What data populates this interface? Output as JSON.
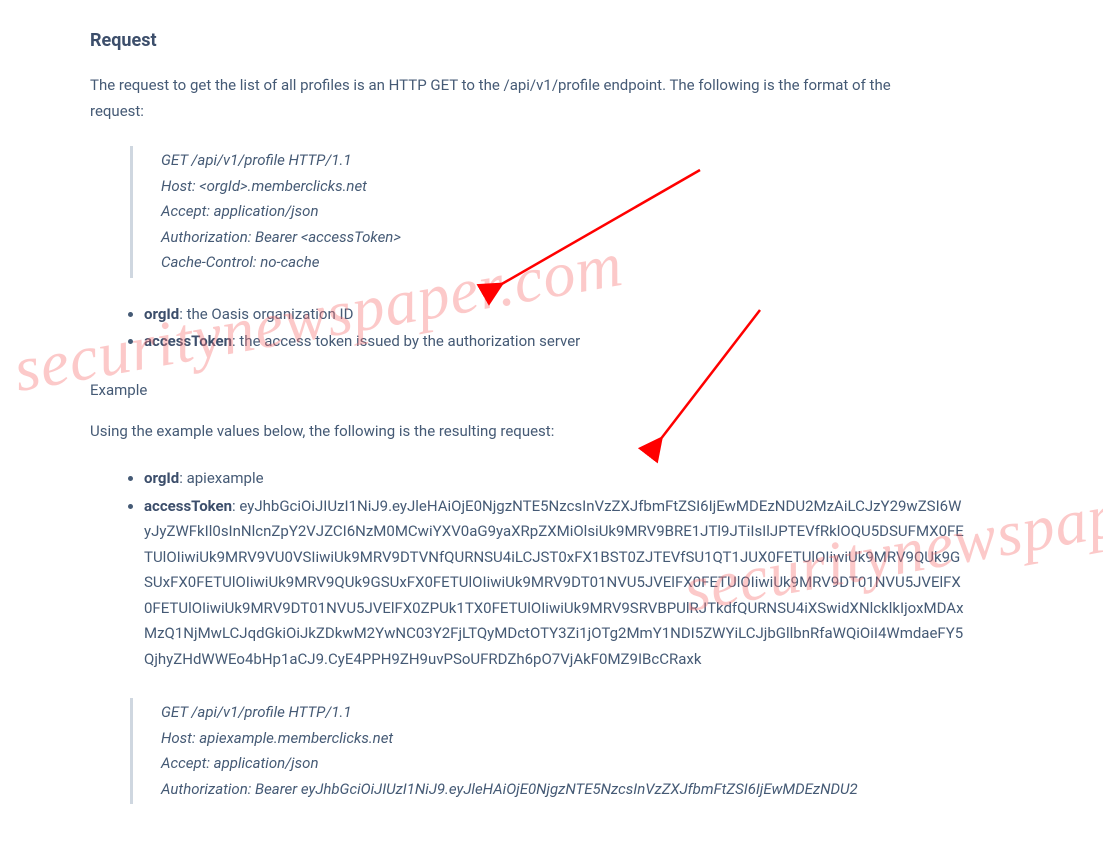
{
  "heading": "Request",
  "intro": "The request to get the list of all profiles is an HTTP GET to the /api/v1/profile endpoint.  The following is the format of the request:",
  "code1": {
    "l1": "GET /api/v1/profile HTTP/1.1",
    "l2": "Host: <orgId>.memberclicks.net",
    "l3": "Accept: application/json",
    "l4": "Authorization: Bearer <accessToken>",
    "l5": "Cache-Control: no-cache"
  },
  "params1": {
    "orgId_label": "orgId",
    "orgId_desc": ": the Oasis organization ID",
    "accessToken_label": "accessToken",
    "accessToken_desc": ": the access token issued by the authorization server"
  },
  "example_heading": "Example",
  "example_intro": "Using the example values below, the following is the resulting request:",
  "params2": {
    "orgId_label": "orgId",
    "orgId_value": ": apiexample",
    "accessToken_label": "accessToken",
    "accessToken_value": ": eyJhbGciOiJIUzI1NiJ9.eyJleHAiOjE0NjgzNTE5NzcsInVzZXJfbmFtZSI6IjEwMDEzNDU2MzAiLCJzY29wZSI6WyJyZWFkIl0sInNlcnZpY2VJZCI6NzM0MCwiYXV0aG9yaXRpZXMiOlsiUk9MRV9BRE1JTl9JTiIsIlJPTEVfRklOQU5DSUFMX0FETUlOIiwiUk9MRV9VU0VSIiwiUk9MRV9DTVNfQURNSU4iLCJST0xFX1BST0ZJTEVfSU1QT1JUX0FETUlOIiwiUk9MRV9QUk9GSUxFX0FETUlOIiwiUk9MRV9QUk9GSUxFX0FETUlOIiwiUk9MRV9DT01NVU5JVElFX0FETUlOIiwiUk9MRV9DT01NVU5JVElFX0FETUlOIiwiUk9MRV9DT01NVU5JVElFX0ZPUk1TX0FETUlOIiwiUk9MRV9SRVBPUlRJTkdfQURNSU4iXSwidXNlcklkIjoxMDAxMzQ1NjMwLCJqdGkiOiJkZDkwM2YwNC03Y2FjLTQyMDctOTY3Zi1jOTg2MmY1NDI5ZWYiLCJjbGllbnRfaWQiOiI4WmdaeFY5QjhyZHdWWEo4bHp1aCJ9.CyE4PPH9ZH9uvPSoUFRDZh6pO7VjAkF0MZ9IBcCRaxk"
  },
  "code2": {
    "l1": "GET /api/v1/profile HTTP/1.1",
    "l2": "Host: apiexample.memberclicks.net",
    "l3": "Accept: application/json",
    "l4": "Authorization: Bearer eyJhbGciOiJIUzI1NiJ9.eyJleHAiOjE0NjgzNTE5NzcsInVzZXJfbmFtZSI6IjEwMDEzNDU2"
  },
  "watermark": "securitynewspaper.com"
}
